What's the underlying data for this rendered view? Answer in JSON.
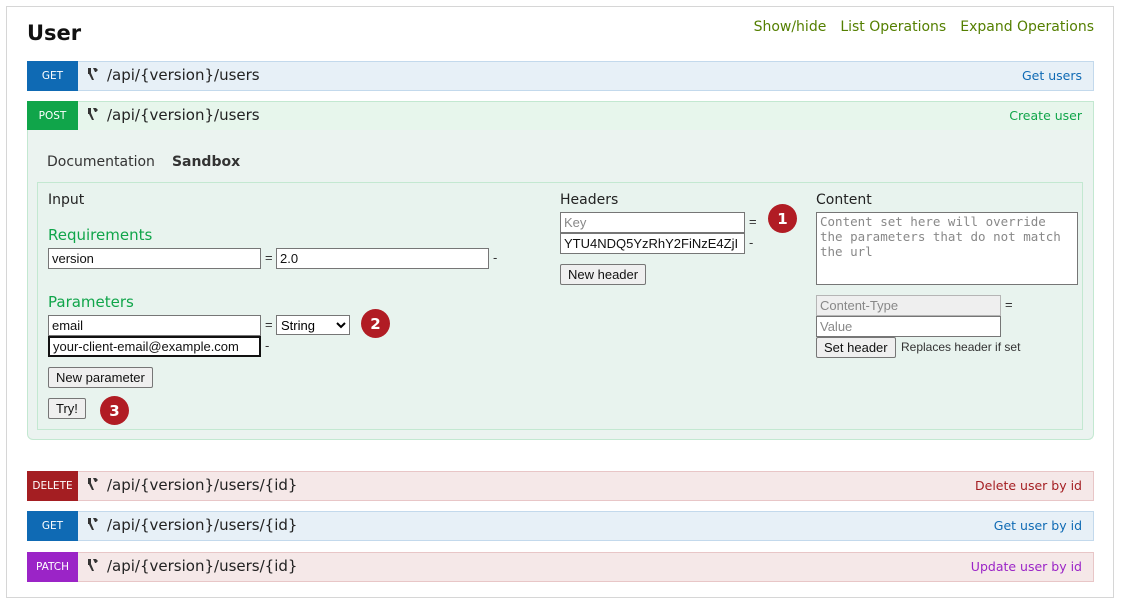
{
  "section": {
    "title": "User",
    "links": [
      "Show/hide",
      "List Operations",
      "Expand Operations"
    ]
  },
  "endpoints": [
    {
      "method": "GET",
      "path": "/api/{version}/users",
      "summary": "Get users"
    },
    {
      "method": "POST",
      "path": "/api/{version}/users",
      "summary": "Create user"
    },
    {
      "method": "DELETE",
      "path": "/api/{version}/users/{id}",
      "summary": "Delete user by id"
    },
    {
      "method": "GET",
      "path": "/api/{version}/users/{id}",
      "summary": "Get user by id"
    },
    {
      "method": "PATCH",
      "path": "/api/{version}/users/{id}",
      "summary": "Update user by id"
    }
  ],
  "key_icon": "wrench-key-icon",
  "tabs": [
    "Documentation",
    "Sandbox"
  ],
  "sandbox": {
    "input_title": "Input",
    "requirements_title": "Requirements",
    "requirement": {
      "name": "version",
      "value": "2.0"
    },
    "parameters_title": "Parameters",
    "parameter": {
      "name": "email",
      "type": "String",
      "value": "your-client-email@example.com"
    },
    "type_options": [
      "String"
    ],
    "new_parameter": "New parameter",
    "try": "Try!",
    "headers_title": "Headers",
    "header_key_placeholder": "Key",
    "header_value": "YTU4NDQ5YzRhY2FiNzE4ZjI",
    "new_header": "New header",
    "content_title": "Content",
    "content_placeholder": "Content set here will override the parameters that do not match the url",
    "content_type_placeholder": "Content-Type",
    "value_placeholder": "Value",
    "set_header": "Set header",
    "set_header_note": "Replaces header if set",
    "eq": "=",
    "dash": "-"
  },
  "badges": [
    "1",
    "2",
    "3"
  ],
  "colors": {
    "get": "#0f6ab4",
    "post": "#10a54a",
    "delete": "#a41e22",
    "patch": "#9b24c7",
    "badge": "#b11c24",
    "link": "#547f00"
  }
}
